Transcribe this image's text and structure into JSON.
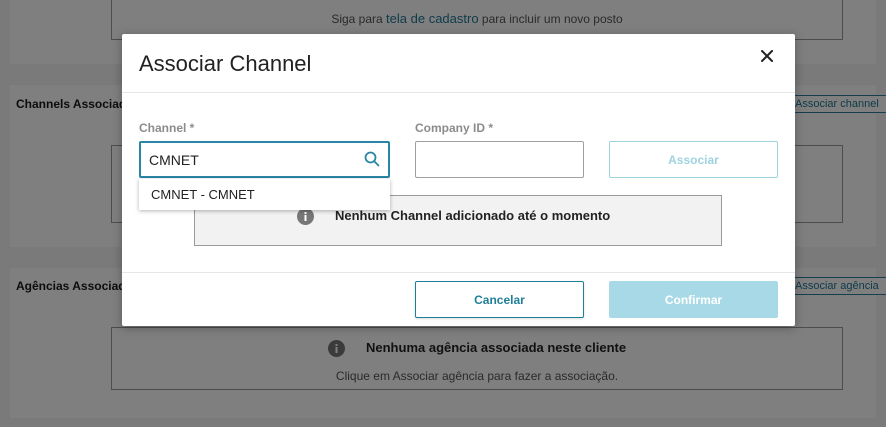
{
  "background": {
    "top_hint_prefix": "Siga para",
    "top_hint_link": "tela de cadastro",
    "top_hint_suffix": "para incluir um novo posto",
    "channels_section_title": "Channels Associados",
    "channels_button": "Associar channel",
    "agencias_section_title": "Agências Associadas",
    "agencias_button": "Associar agência",
    "agencias_empty_title": "Nenhuma agência associada neste cliente",
    "agencias_empty_hint": "Clique em Associar agência para fazer a associação."
  },
  "modal": {
    "title": "Associar Channel",
    "channel_label": "Channel *",
    "channel_value": "CMNET",
    "company_label": "Company ID *",
    "company_value": "",
    "associate_button": "Associar",
    "dropdown_options": [
      "CMNET - CMNET"
    ],
    "empty_message": "Nenhum Channel adicionado até o momento",
    "cancel_button": "Cancelar",
    "confirm_button": "Confirmar"
  },
  "colors": {
    "accent": "#1f7f99",
    "accent_light": "#a7dae6",
    "overlay": "rgba(0,0,0,0.5)"
  },
  "icons": [
    "close-icon",
    "search-icon",
    "info-icon"
  ]
}
